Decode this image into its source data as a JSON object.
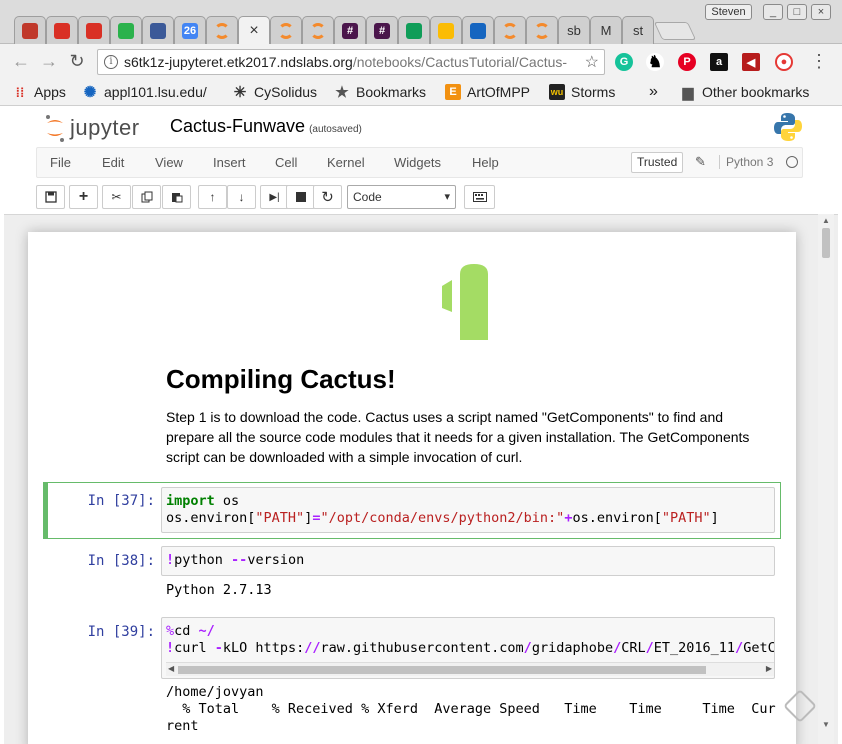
{
  "browser": {
    "tabs": [
      {
        "icon": "settings-circle-icon",
        "color": "#c0392b",
        "active": false
      },
      {
        "icon": "gmail-icon",
        "color": "#d93025",
        "active": false
      },
      {
        "icon": "gmail-icon",
        "color": "#d93025",
        "active": false
      },
      {
        "icon": "feedly-icon",
        "color": "#2bb24c",
        "active": false
      },
      {
        "icon": "facebook-icon",
        "color": "#3b5998",
        "active": false
      },
      {
        "icon": "calendar-icon",
        "color": "#4285f4",
        "glyph": "26",
        "active": false
      },
      {
        "icon": "jupyter-icon",
        "color": "#f48a2c",
        "active": false
      },
      {
        "icon": "jupyter-icon",
        "color": "#f48a2c",
        "active": true,
        "glyph": "×"
      },
      {
        "icon": "jupyter-icon",
        "color": "#f48a2c",
        "active": false
      },
      {
        "icon": "jupyter-icon",
        "color": "#f48a2c",
        "active": false
      },
      {
        "icon": "slack-icon",
        "color": "#4a154b",
        "glyph": "#",
        "active": false
      },
      {
        "icon": "slack-icon",
        "color": "#4a154b",
        "glyph": "#",
        "active": false
      },
      {
        "icon": "sheets-icon",
        "color": "#0f9d58",
        "active": false
      },
      {
        "icon": "drive-icon",
        "color": "#fbbc04",
        "active": false
      },
      {
        "icon": "database-icon",
        "color": "#1565c0",
        "active": false
      },
      {
        "icon": "jupyter-icon",
        "color": "#f48a2c",
        "active": false
      },
      {
        "icon": "jupyter-icon",
        "color": "#f48a2c",
        "active": false
      },
      {
        "icon": "text-tab",
        "text": "sb",
        "active": false
      },
      {
        "icon": "text-tab",
        "text": "M",
        "active": false
      },
      {
        "icon": "text-tab",
        "text": "st",
        "active": false
      }
    ],
    "user_chip": "Steven",
    "url_host": "s6tk1z-jupyteret.etk2017.ndslabs.org",
    "url_path": "/notebooks/CactusTutorial/Cactus-",
    "bookmarks": {
      "apps": "Apps",
      "appl101": "appl101.lsu.edu/",
      "cysolidus": "CySolidus",
      "bookmarks": "Bookmarks",
      "artofmpp": "ArtOfMPP",
      "storms": "Storms",
      "more": "»",
      "other": "Other bookmarks"
    }
  },
  "jupyter": {
    "wordmark": "jupyter",
    "notebook_title": "Cactus-Funwave",
    "save_status": "(autosaved)",
    "menu": [
      "File",
      "Edit",
      "View",
      "Insert",
      "Cell",
      "Kernel",
      "Widgets",
      "Help"
    ],
    "trusted": "Trusted",
    "kernel": "Python 3",
    "cell_type": "Code",
    "colors": {
      "accent": "#f37726",
      "selected_cell": "#66bb6a",
      "prompt": "#303f9f",
      "cactus_green": "#a4dc64"
    }
  },
  "notebook": {
    "heading": "Compiling Cactus!",
    "paragraph": "Step 1 is to download the code. Cactus uses a script named \"GetComponents\" to find and prepare all the source code modules that it needs for a given installation. The GetComponents script can be downloaded with a simple invocation of curl.",
    "cells": [
      {
        "prompt": "In [37]:"
      },
      {
        "prompt": "In [38]:",
        "output": "Python 2.7.13"
      },
      {
        "prompt": "In [39]:",
        "output": "/home/jovyan\n  % Total    % Received % Xferd  Average Speed   Time    Time     Time  Cur\nrent"
      }
    ]
  }
}
